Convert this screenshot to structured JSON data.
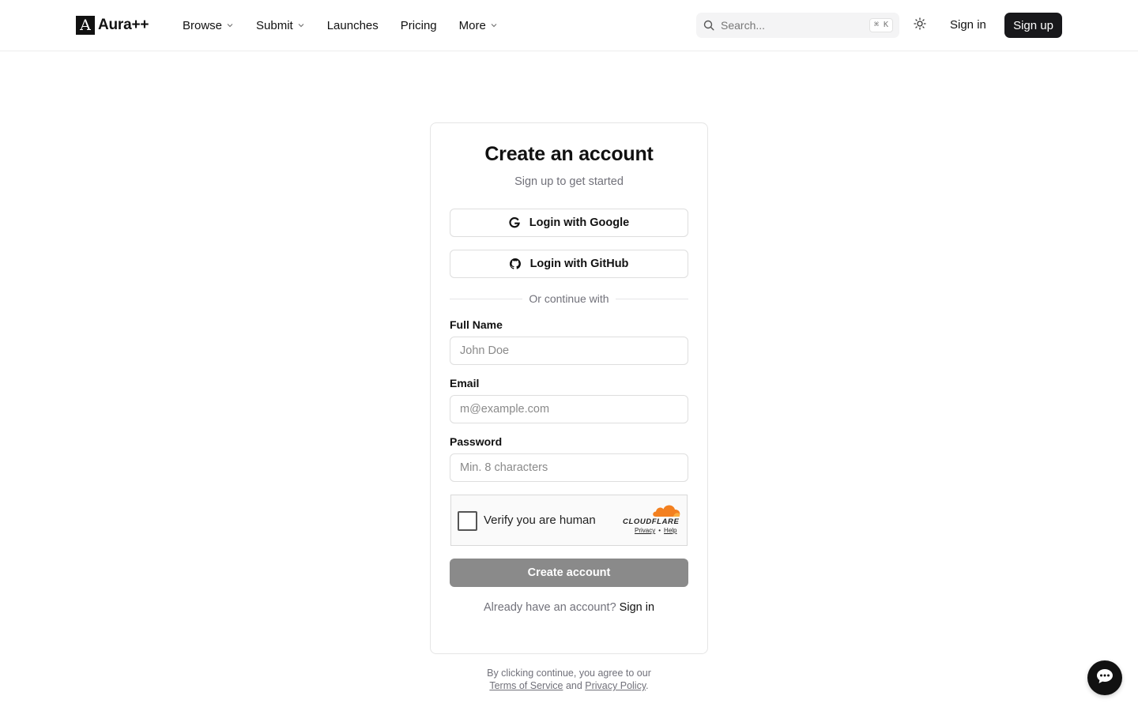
{
  "header": {
    "logo": {
      "mark": "A",
      "text": "Aura++"
    },
    "nav": [
      {
        "label": "Browse",
        "dropdown": true
      },
      {
        "label": "Submit",
        "dropdown": true
      },
      {
        "label": "Launches",
        "dropdown": false
      },
      {
        "label": "Pricing",
        "dropdown": false
      },
      {
        "label": "More",
        "dropdown": true
      }
    ],
    "search": {
      "placeholder": "Search...",
      "shortcut": "⌘ K"
    },
    "theme_toggle_icon": "sun-icon",
    "signin_label": "Sign in",
    "signup_label": "Sign up"
  },
  "form": {
    "title": "Create an account",
    "subtitle": "Sign up to get started",
    "google_label": "Login with Google",
    "github_label": "Login with GitHub",
    "divider": "Or continue with",
    "fields": {
      "name": {
        "label": "Full Name",
        "placeholder": "John Doe",
        "value": ""
      },
      "email": {
        "label": "Email",
        "placeholder": "m@example.com",
        "value": ""
      },
      "password": {
        "label": "Password",
        "placeholder": "Min. 8 characters",
        "value": ""
      }
    },
    "captcha": {
      "text": "Verify you are human",
      "brand": "CLOUDFLARE",
      "privacy": "Privacy",
      "separator": "•",
      "help": "Help",
      "checked": false
    },
    "submit_label": "Create account",
    "already_text": "Already have an account?",
    "signin_link": "Sign in"
  },
  "footer": {
    "terms_prefix": "By clicking continue, you agree to our",
    "terms_link": "Terms of Service",
    "and": "and",
    "privacy_link": "Privacy Policy",
    "period": "."
  },
  "colors": {
    "primary": "#18181b",
    "disabled_button": "#8a8a8a",
    "muted_text": "#71717a",
    "border": "#e5e5e5",
    "cloudflare_orange": "#f38020"
  },
  "chat_icon": "chat-bubble-icon"
}
